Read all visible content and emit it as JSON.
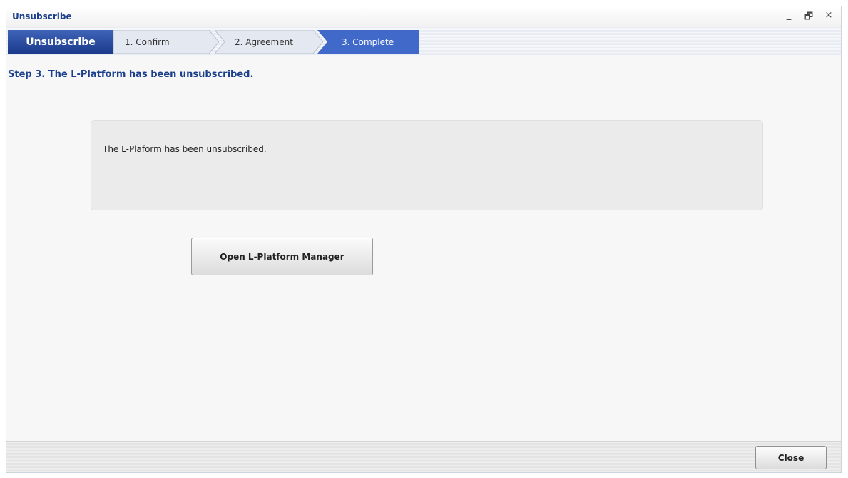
{
  "window": {
    "title": "Unsubscribe",
    "controls": {
      "minimize": "_",
      "restore": "🗗",
      "close": "×"
    }
  },
  "stepbar": {
    "main_label": "Unsubscribe",
    "steps": [
      {
        "label": "1. Confirm",
        "active": false
      },
      {
        "label": "2. Agreement",
        "active": false
      },
      {
        "label": "3. Complete",
        "active": true
      }
    ]
  },
  "main": {
    "heading": "Step 3. The L-Platform has been unsubscribed.",
    "message": "The L-Plaform has been unsubscribed.",
    "open_button_label": "Open L-Platform Manager"
  },
  "footer": {
    "close_button_label": "Close"
  },
  "colors": {
    "accent": "#1b3f8b",
    "step_active": "#3d62c5",
    "step_inactive": "#dfe4ee"
  }
}
